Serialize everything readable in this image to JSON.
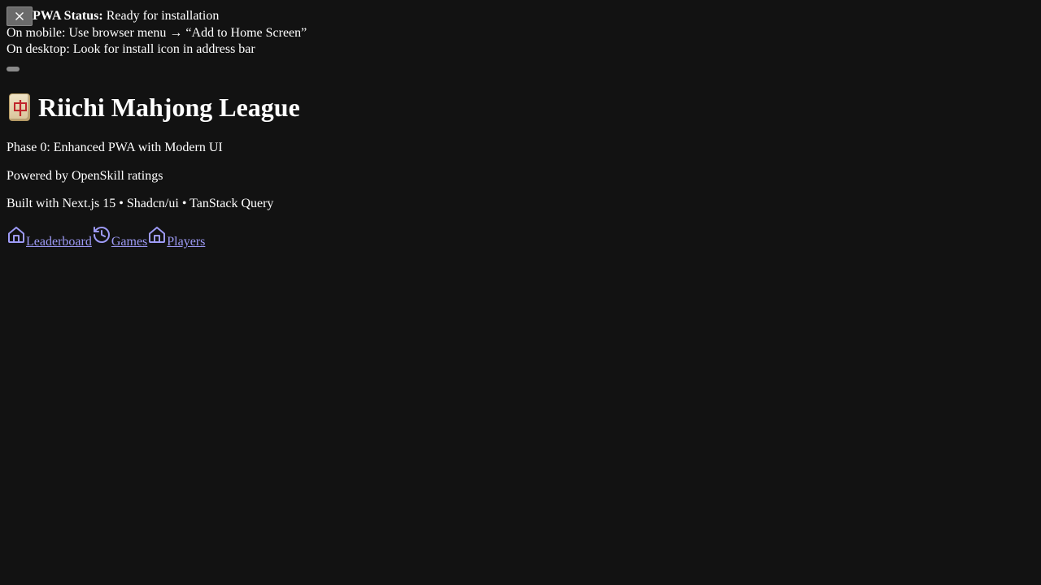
{
  "pwa": {
    "status_label": "PWA Status:",
    "status_value": "Ready for installation",
    "mobile_hint": "On mobile: Use browser menu → “Add to Home Screen”",
    "desktop_hint": "On desktop: Look for install icon in address bar"
  },
  "header": {
    "title": "Riichi Mahjong League"
  },
  "info": {
    "phase": "Phase 0: Enhanced PWA with Modern UI",
    "powered_by": "Powered by OpenSkill ratings",
    "built_with": "Built with Next.js 15 • Shadcn/ui • TanStack Query"
  },
  "nav": {
    "items": [
      {
        "label": "Leaderboard",
        "icon": "home-icon"
      },
      {
        "label": "Games",
        "icon": "history-icon"
      },
      {
        "label": "Players",
        "icon": "home-icon"
      }
    ]
  },
  "colors": {
    "background": "#121212",
    "text": "#ffffff",
    "link": "#9d9af5",
    "button": "#6b6b6b"
  }
}
